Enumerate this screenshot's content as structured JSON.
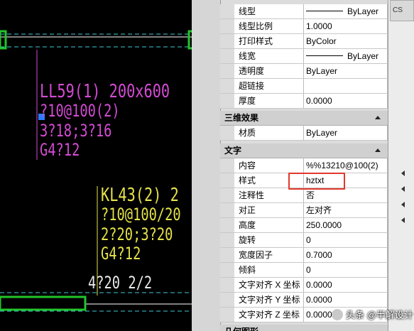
{
  "canvas": {
    "annotations": [
      {
        "id": "ll59-line1",
        "text": "LL59(1) 200x600",
        "color": "magenta"
      },
      {
        "id": "ll59-line2",
        "text": "?10@100(2)",
        "color": "magenta"
      },
      {
        "id": "ll59-line3",
        "text": "3?18;3?16",
        "color": "magenta"
      },
      {
        "id": "ll59-line4",
        "text": "G4?12",
        "color": "magenta"
      },
      {
        "id": "kl43-line1",
        "text": "KL43(2) 2",
        "color": "yellow"
      },
      {
        "id": "kl43-line2",
        "text": "?10@100/20",
        "color": "yellow"
      },
      {
        "id": "kl43-line3",
        "text": "2?20;3?20",
        "color": "yellow"
      },
      {
        "id": "kl43-line4",
        "text": "G4?12",
        "color": "yellow"
      },
      {
        "id": "rebar-note",
        "text": "4?20 2/2",
        "color": "white"
      }
    ],
    "colors": {
      "magenta": "#d54bd4",
      "yellow": "#e6e34a",
      "green": "#22c52a",
      "cyan": "#3fc9d6",
      "white": "#e8e8e8"
    }
  },
  "properties": {
    "general_rows": [
      {
        "label": "线型",
        "value": "ByLayer",
        "swatch": true
      },
      {
        "label": "线型比例",
        "value": "1.0000"
      },
      {
        "label": "打印样式",
        "value": "ByColor"
      },
      {
        "label": "线宽",
        "value": "ByLayer",
        "swatch": true
      },
      {
        "label": "透明度",
        "value": "ByLayer"
      },
      {
        "label": "超链接",
        "value": ""
      },
      {
        "label": "厚度",
        "value": "0.0000"
      }
    ],
    "section_3d": {
      "title": "三维效果"
    },
    "rows_3d": [
      {
        "label": "材质",
        "value": "ByLayer"
      }
    ],
    "section_text": {
      "title": "文字"
    },
    "text_rows": [
      {
        "label": "内容",
        "value": "%%13210@100(2)"
      },
      {
        "label": "样式",
        "value": "hztxt"
      },
      {
        "label": "注释性",
        "value": "否"
      },
      {
        "label": "对正",
        "value": "左对齐"
      },
      {
        "label": "高度",
        "value": "250.0000"
      },
      {
        "label": "旋转",
        "value": "0"
      },
      {
        "label": "宽度因子",
        "value": "0.7000"
      },
      {
        "label": "倾斜",
        "value": "0"
      },
      {
        "label": "文字对齐 X 坐标",
        "value": "0.0000"
      },
      {
        "label": "文字对齐 Y 坐标",
        "value": "0.0000"
      },
      {
        "label": "文字对齐 Z 坐标",
        "value": "0.0000"
      }
    ],
    "section_geometry": {
      "title": "几何图形"
    },
    "highlight_color": "#e0392b"
  },
  "side_panel": {
    "tab_label": "CS"
  },
  "watermark": {
    "text": "头条 @半解设计"
  }
}
